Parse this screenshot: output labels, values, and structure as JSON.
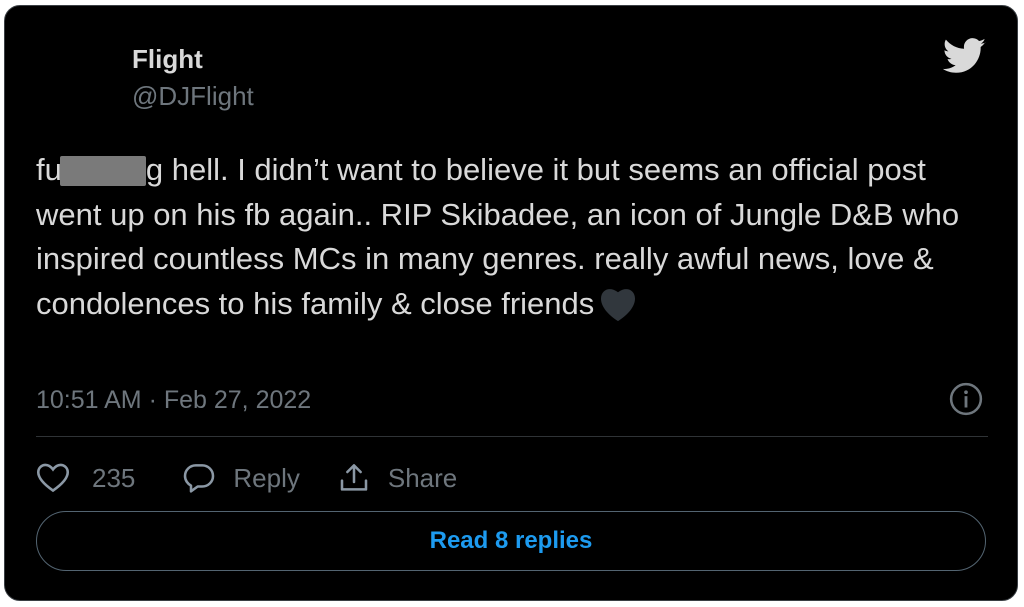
{
  "tweet": {
    "display_name": "Flight",
    "handle": "@DJFlight",
    "text_prefix": "fu",
    "text_after_redaction": "g hell. I didn’t want to believe it but seems an official post went up on his fb again.. RIP Skibadee, an icon of Jungle D&B who inspired countless MCs in many genres. really awful news, love & condolences to his family & close friends",
    "timestamp": "10:51 AM · Feb 27, 2022",
    "emoji": "black-heart-icon"
  },
  "actions": {
    "like_count": "235",
    "reply_label": "Reply",
    "share_label": "Share"
  },
  "read_replies_label": "Read 8 replies",
  "colors": {
    "background": "#000000",
    "text": "#d9d9d9",
    "muted": "#6e767d",
    "accent": "#1d9bf0"
  }
}
